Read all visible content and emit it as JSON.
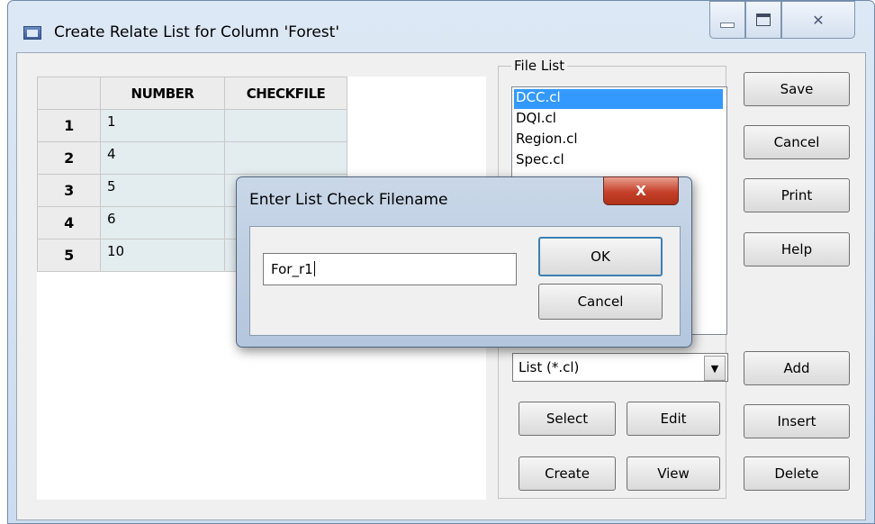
{
  "window": {
    "title": "Create Relate List for Column 'Forest'",
    "controls": {
      "minimize": "—",
      "maximize": "▣",
      "close": "✕"
    }
  },
  "grid": {
    "columns": [
      "NUMBER",
      "CHECKFILE"
    ],
    "rows": [
      {
        "num": "1",
        "number": "1",
        "checkfile": ""
      },
      {
        "num": "2",
        "number": "4",
        "checkfile": ""
      },
      {
        "num": "3",
        "number": "5",
        "checkfile": ""
      },
      {
        "num": "4",
        "number": "6",
        "checkfile": ""
      },
      {
        "num": "5",
        "number": "10",
        "checkfile": ""
      }
    ]
  },
  "file_list": {
    "label": "File List",
    "items": [
      "DCC.cl",
      "DQI.cl",
      "Region.cl",
      "Spec.cl"
    ],
    "selected_index": 0,
    "filter": "List (*.cl)",
    "buttons": {
      "select": "Select",
      "edit": "Edit",
      "create": "Create",
      "view": "View"
    }
  },
  "side_buttons": {
    "save": "Save",
    "cancel": "Cancel",
    "print": "Print",
    "help": "Help",
    "add": "Add",
    "insert": "Insert",
    "delete": "Delete"
  },
  "dialog": {
    "title": "Enter List Check Filename",
    "close": "X",
    "input_value": "For_r1",
    "ok": "OK",
    "cancel": "Cancel"
  },
  "colors": {
    "selection": "#3399ff",
    "grid_cell": "#e3ecef",
    "dialog_close": "#c5402a"
  }
}
